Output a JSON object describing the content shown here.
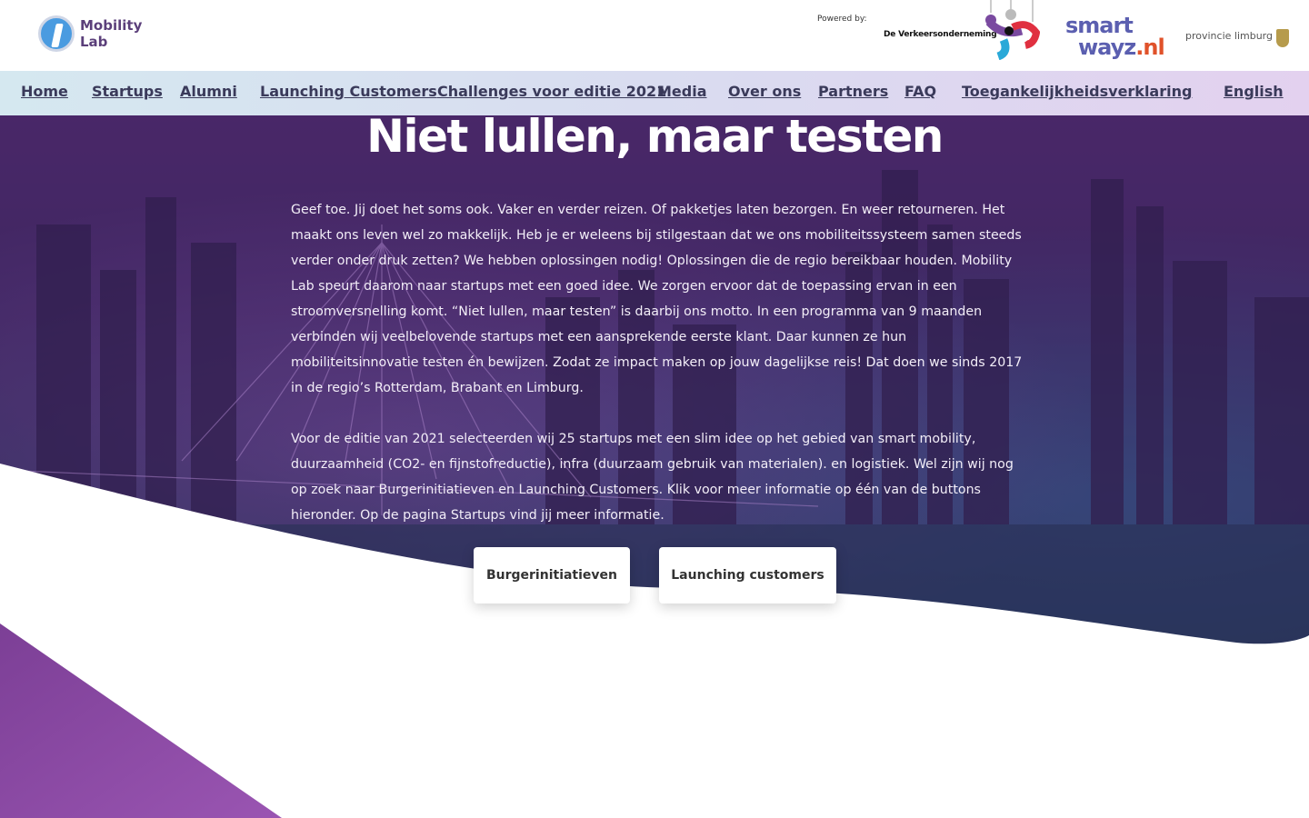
{
  "brand": {
    "logo_line1": "Mobility",
    "logo_line2": "Lab"
  },
  "partners": {
    "powered_label": "Powered by:",
    "verkeersonderneming": "De Verkeersonderneming",
    "smartwayz_line1": "smart",
    "smartwayz_line2": "wayz",
    "smartwayz_tld": ".nl",
    "limburg": "provincie limburg"
  },
  "nav": {
    "items": [
      {
        "label": "Home"
      },
      {
        "label": "Startups"
      },
      {
        "label": "Alumni"
      },
      {
        "label": "Launching Customers"
      },
      {
        "label": "Challenges voor editie 2021"
      },
      {
        "label": "Media"
      },
      {
        "label": "Over ons"
      },
      {
        "label": "Partners"
      },
      {
        "label": "FAQ"
      },
      {
        "label": "Toegankelijkheidsverklaring"
      }
    ],
    "language": "English"
  },
  "hero": {
    "title": "Niet lullen, maar testen",
    "paragraph1": "Geef toe. Jij doet het soms ook. Vaker en verder reizen. Of pakketjes laten bezorgen. En weer retourneren. Het maakt ons leven wel zo makkelijk. Heb je er weleens bij stilgestaan dat we ons mobiliteitssysteem samen steeds verder onder druk zetten? We hebben oplossingen nodig! Oplossingen die de regio bereikbaar houden. Mobility Lab speurt daarom naar startups met een goed idee. We zorgen ervoor dat de toepassing ervan in een stroomversnelling komt. “Niet lullen, maar testen” is daarbij ons motto. In een programma van 9 maanden verbinden wij veelbelovende startups met een aansprekende eerste klant. Daar kunnen ze hun mobiliteitsinnovatie testen én bewijzen. Zodat ze impact maken op jouw dagelijkse reis! Dat doen we sinds 2017 in de regio’s Rotterdam, Brabant en Limburg.",
    "paragraph2": "Voor de editie van 2021 selecteerden wij 25 startups met een slim idee op het gebied van smart mobility, duurzaamheid (CO2- en fijnstofreductie), infra (duurzaam gebruik van materialen). en logistiek. Wel zijn wij  nog op zoek naar Burgerinitiatieven en Launching Customers. Klik voor meer informatie op één van de buttons hieronder. Op de pagina Startups vind jij meer informatie."
  },
  "buttons": {
    "burgerinitiatieven": "Burgerinitiatieven",
    "launching_customers": "Launching customers"
  },
  "colors": {
    "nav_gradient_start": "#d5e8f0",
    "nav_gradient_end": "#e3d1ef",
    "accent_purple": "#8e4aa5",
    "text_dark": "#3a3a5a"
  }
}
